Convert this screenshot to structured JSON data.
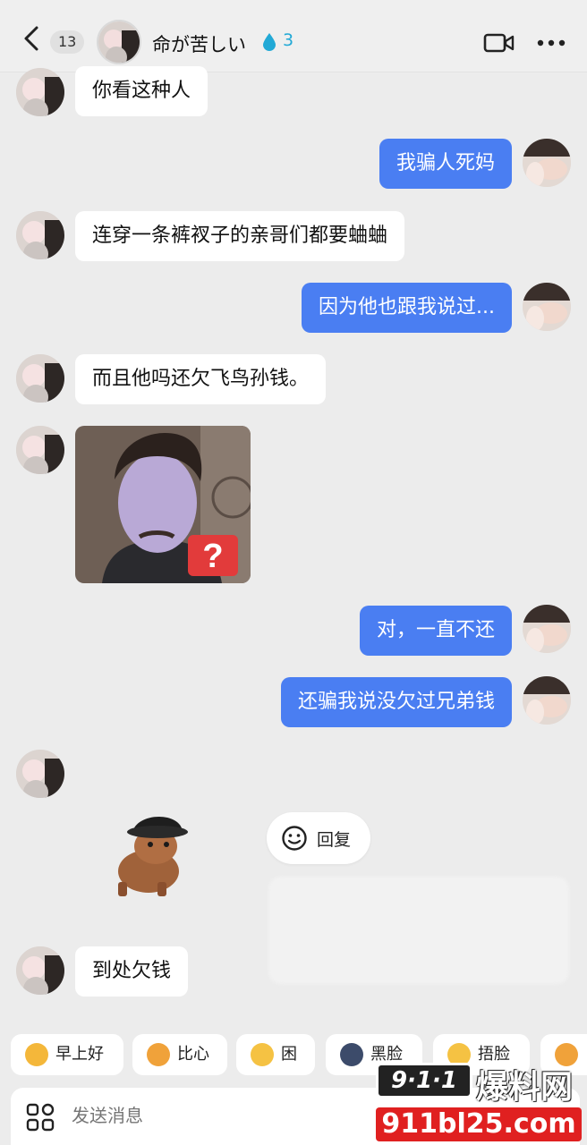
{
  "header": {
    "unread_count": "13",
    "contact_name": "命が苦しい",
    "drop_count": "3",
    "icons": {
      "back": "chevron-left-icon",
      "drop": "water-drop-icon",
      "video": "video-call-icon",
      "more": "more-icon"
    }
  },
  "messages": [
    {
      "side": "in",
      "text": "你看这种人"
    },
    {
      "side": "out",
      "text": "我骗人死妈"
    },
    {
      "side": "in",
      "text": "连穿一条裤衩子的亲哥们都要蛐蛐"
    },
    {
      "side": "out",
      "text": "因为他也跟我说过..."
    },
    {
      "side": "in",
      "text": "而且他吗还欠飞鸟孙钱。"
    },
    {
      "side": "in",
      "type": "image",
      "badge": "?"
    },
    {
      "side": "out",
      "text": "对，一直不还"
    },
    {
      "side": "out",
      "text": "还骗我说没欠过兄弟钱"
    },
    {
      "side": "in",
      "type": "sticker"
    },
    {
      "side": "in",
      "text": "到处欠钱"
    }
  ],
  "reply_popup": {
    "label": "回复"
  },
  "quick_replies": [
    {
      "label": "早上好",
      "color": "#f4b73a"
    },
    {
      "label": "比心",
      "color": "#f0a23a"
    },
    {
      "label": "困",
      "color": "#f5c243"
    },
    {
      "label": "黑脸",
      "color": "#3c4b6a"
    },
    {
      "label": "捂脸",
      "color": "#f5c243"
    }
  ],
  "input": {
    "placeholder": "发送消息"
  },
  "watermark": {
    "logo": "9·1·1",
    "title": "爆料网",
    "url": "911bl25.com"
  },
  "colors": {
    "outgoing_bubble": "#4a7ef2",
    "incoming_bubble": "#ffffff",
    "background": "#ececec",
    "drop": "#22a9d6"
  }
}
